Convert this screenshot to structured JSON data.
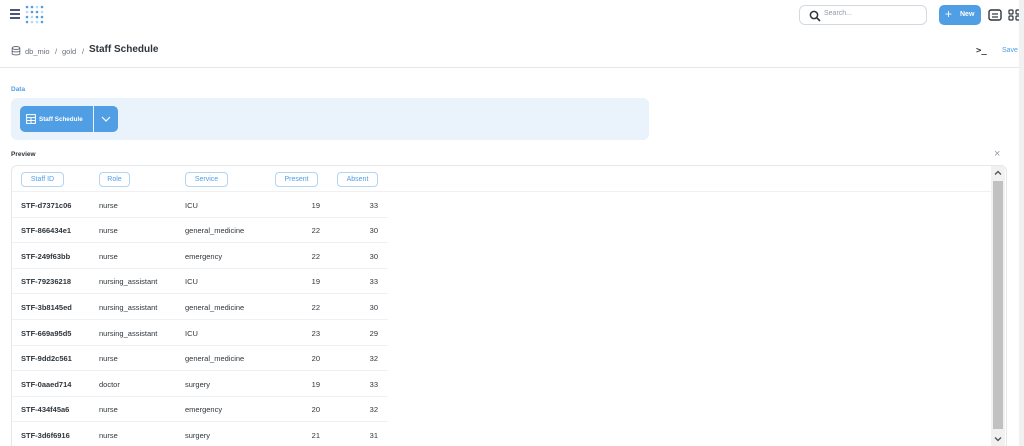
{
  "topbar": {
    "search_placeholder": "Search...",
    "new_label": "New",
    "plus_glyph": "+",
    "icons": [
      "menu-icon",
      "logo-icon",
      "search-icon",
      "plus-icon",
      "keyboard-icon",
      "apps-grid-icon"
    ]
  },
  "breadcrumb": {
    "database": "db_mio",
    "sep1": "/",
    "schema": "gold",
    "sep2": "/",
    "title": "Staff Schedule"
  },
  "header": {
    "terminal_glyph": ">_",
    "save_label": "Save"
  },
  "data_section": {
    "label": "Data",
    "table_name": "Staff Schedule"
  },
  "preview": {
    "label": "Preview",
    "close_glyph": "×",
    "columns": [
      "Staff ID",
      "Role",
      "Service",
      "Present",
      "Absent"
    ],
    "rows": [
      [
        "STF-d7371c06",
        "nurse",
        "ICU",
        "19",
        "33"
      ],
      [
        "STF-866434e1",
        "nurse",
        "general_medicine",
        "22",
        "30"
      ],
      [
        "STF-249f63bb",
        "nurse",
        "emergency",
        "22",
        "30"
      ],
      [
        "STF-79236218",
        "nursing_assistant",
        "ICU",
        "19",
        "33"
      ],
      [
        "STF-3b8145ed",
        "nursing_assistant",
        "general_medicine",
        "22",
        "30"
      ],
      [
        "STF-669a95d5",
        "nursing_assistant",
        "ICU",
        "23",
        "29"
      ],
      [
        "STF-9dd2c561",
        "nurse",
        "general_medicine",
        "20",
        "32"
      ],
      [
        "STF-0aaed714",
        "doctor",
        "surgery",
        "19",
        "33"
      ],
      [
        "STF-434f45a6",
        "nurse",
        "emergency",
        "20",
        "32"
      ],
      [
        "STF-3d6f6916",
        "nurse",
        "surgery",
        "21",
        "31"
      ]
    ]
  },
  "colors": {
    "accent": "#509ee3",
    "panel_bg": "#eaf3fc",
    "text_dark": "#2e353b"
  }
}
